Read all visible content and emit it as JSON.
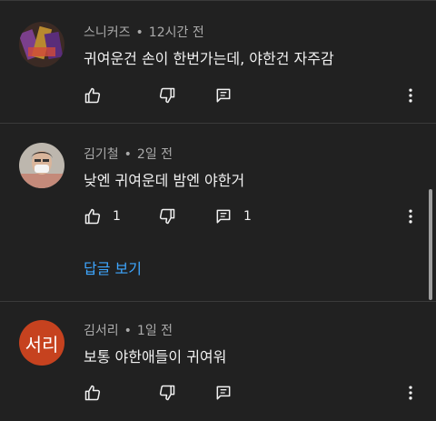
{
  "comments": [
    {
      "author": "스니커즈",
      "time": "12시간 전",
      "text": "귀여운건 손이 한번가는데, 야한건 자주감",
      "likes": "",
      "replies_count": ""
    },
    {
      "author": "김기철",
      "time": "2일 전",
      "text": "낮엔 귀여운데 밤엔 야한거",
      "likes": "1",
      "replies_count": "1",
      "view_replies": "답글 보기"
    },
    {
      "author": "김서리",
      "time": "1일 전",
      "avatar_text": "서리",
      "text": "보통 야한애들이 귀여워",
      "likes": "",
      "replies_count": ""
    }
  ],
  "separator": "•",
  "colors": {
    "background": "#212121",
    "link": "#3ea6ff",
    "avatar_seori": "#c6421f"
  },
  "icons": [
    "thumbs-up-icon",
    "thumbs-down-icon",
    "reply-icon",
    "more-vert-icon"
  ]
}
